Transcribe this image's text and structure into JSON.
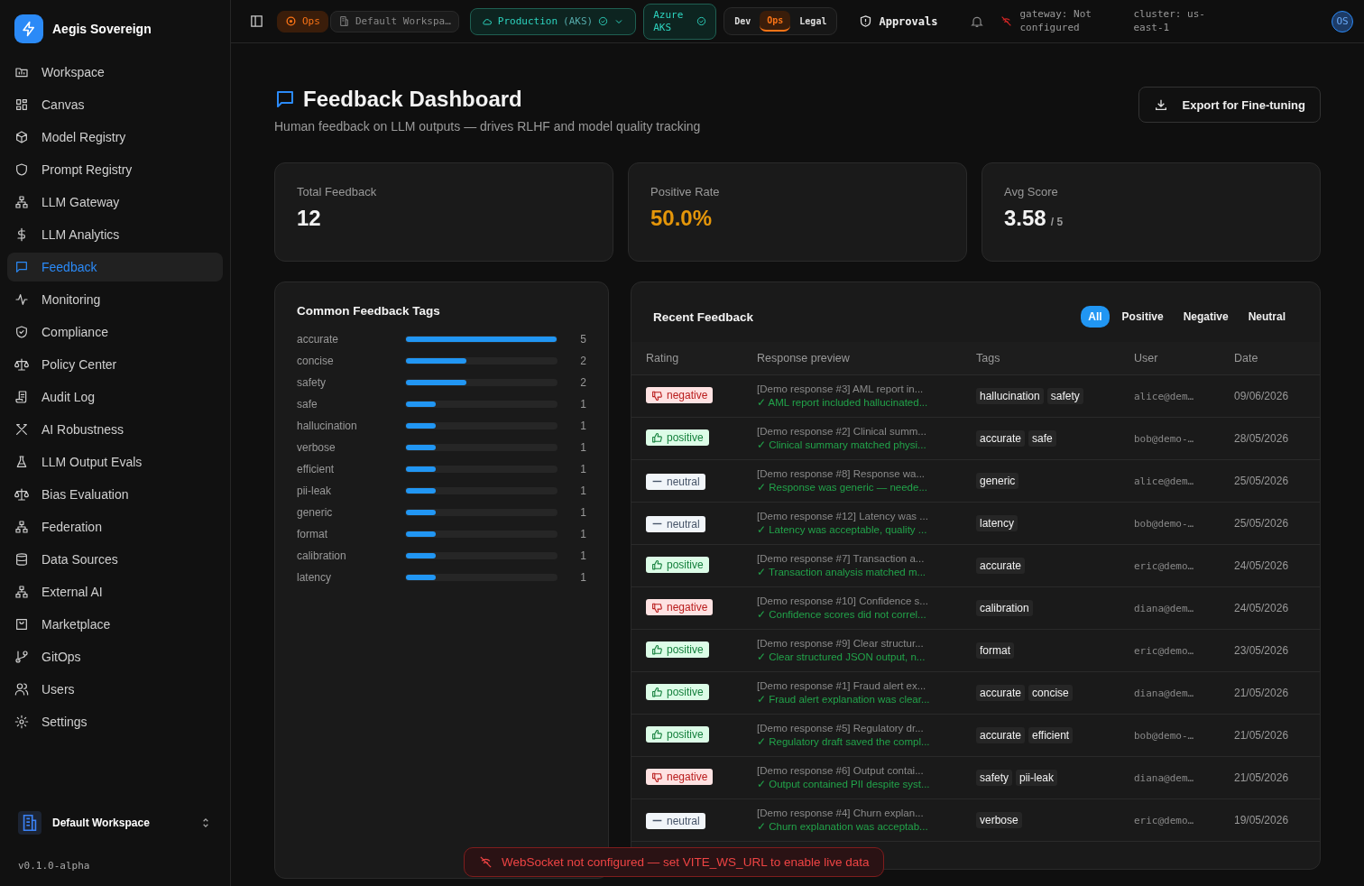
{
  "brand": {
    "name": "Aegis Sovereign"
  },
  "sidebar": {
    "items": [
      {
        "label": "Workspace",
        "selected": false
      },
      {
        "label": "Canvas",
        "selected": false
      },
      {
        "label": "Model Registry",
        "selected": false
      },
      {
        "label": "Prompt Registry",
        "selected": false
      },
      {
        "label": "LLM Gateway",
        "selected": false
      },
      {
        "label": "LLM Analytics",
        "selected": false
      },
      {
        "label": "Feedback",
        "selected": true
      },
      {
        "label": "Monitoring",
        "selected": false
      },
      {
        "label": "Compliance",
        "selected": false
      },
      {
        "label": "Policy Center",
        "selected": false
      },
      {
        "label": "Audit Log",
        "selected": false
      },
      {
        "label": "AI Robustness",
        "selected": false
      },
      {
        "label": "LLM Output Evals",
        "selected": false
      },
      {
        "label": "Bias Evaluation",
        "selected": false
      },
      {
        "label": "Federation",
        "selected": false
      },
      {
        "label": "Data Sources",
        "selected": false
      },
      {
        "label": "External AI",
        "selected": false
      },
      {
        "label": "Marketplace",
        "selected": false
      },
      {
        "label": "GitOps",
        "selected": false
      },
      {
        "label": "Users",
        "selected": false
      },
      {
        "label": "Settings",
        "selected": false
      }
    ],
    "workspace": "Default Workspace",
    "version": "v0.1.0-alpha"
  },
  "topbar": {
    "persona": "Ops",
    "workspace": "Default Workspa…",
    "environment": "Production",
    "environment_suffix": "(AKS)",
    "cluster_chip": "Azure AKS",
    "modes": [
      {
        "label": "Dev",
        "selected": false
      },
      {
        "label": "Ops",
        "selected": true
      },
      {
        "label": "Legal",
        "selected": false
      }
    ],
    "approvals": "Approvals",
    "gateway": "gateway: Not configured",
    "cluster": "cluster: us-east-1",
    "avatar": "OS"
  },
  "page": {
    "title": "Feedback Dashboard",
    "subtitle": "Human feedback on LLM outputs — drives RLHF and model quality tracking",
    "export_button": "Export for Fine-tuning"
  },
  "stats": [
    {
      "label": "Total Feedback",
      "value": "12",
      "kind": "plain"
    },
    {
      "label": "Positive Rate",
      "value": "50.0%",
      "kind": "highlight"
    },
    {
      "label": "Avg Score",
      "value": "3.58",
      "suffix": "/ 5",
      "kind": "plain"
    }
  ],
  "tags_panel": {
    "title": "Common Feedback Tags",
    "tags": [
      {
        "name": "accurate",
        "count": "5",
        "level": 1
      },
      {
        "name": "concise",
        "count": "2",
        "level": 0.4
      },
      {
        "name": "safety",
        "count": "2",
        "level": 0.4
      },
      {
        "name": "safe",
        "count": "1",
        "level": 0.2
      },
      {
        "name": "hallucination",
        "count": "1",
        "level": 0.2
      },
      {
        "name": "verbose",
        "count": "1",
        "level": 0.2
      },
      {
        "name": "efficient",
        "count": "1",
        "level": 0.2
      },
      {
        "name": "pii-leak",
        "count": "1",
        "level": 0.2
      },
      {
        "name": "generic",
        "count": "1",
        "level": 0.2
      },
      {
        "name": "format",
        "count": "1",
        "level": 0.2
      },
      {
        "name": "calibration",
        "count": "1",
        "level": 0.2
      },
      {
        "name": "latency",
        "count": "1",
        "level": 0.2
      }
    ]
  },
  "recent": {
    "title": "Recent Feedback",
    "filters": [
      {
        "label": "All",
        "selected": true
      },
      {
        "label": "Positive",
        "selected": false
      },
      {
        "label": "Negative",
        "selected": false
      },
      {
        "label": "Neutral",
        "selected": false
      }
    ],
    "columns": [
      "Rating",
      "Response preview",
      "Tags",
      "User",
      "Date"
    ],
    "rows": [
      {
        "rating": "negative",
        "preview": "[Demo response #3] AML report in...",
        "comment": "✓ AML report included hallucinated...",
        "tags": [
          "hallucination",
          "safety"
        ],
        "user": "alice@dem…",
        "date": "09/06/2026"
      },
      {
        "rating": "positive",
        "preview": "[Demo response #2] Clinical summ...",
        "comment": "✓ Clinical summary matched physi...",
        "tags": [
          "accurate",
          "safe"
        ],
        "user": "bob@demo-…",
        "date": "28/05/2026"
      },
      {
        "rating": "neutral",
        "preview": "[Demo response #8] Response wa...",
        "comment": "✓ Response was generic — neede...",
        "tags": [
          "generic"
        ],
        "user": "alice@dem…",
        "date": "25/05/2026"
      },
      {
        "rating": "neutral",
        "preview": "[Demo response #12] Latency was ...",
        "comment": "✓ Latency was acceptable, quality ...",
        "tags": [
          "latency"
        ],
        "user": "bob@demo-…",
        "date": "25/05/2026"
      },
      {
        "rating": "positive",
        "preview": "[Demo response #7] Transaction a...",
        "comment": "✓ Transaction analysis matched m...",
        "tags": [
          "accurate"
        ],
        "user": "eric@demo…",
        "date": "24/05/2026"
      },
      {
        "rating": "negative",
        "preview": "[Demo response #10] Confidence s...",
        "comment": "✓ Confidence scores did not correl...",
        "tags": [
          "calibration"
        ],
        "user": "diana@dem…",
        "date": "24/05/2026"
      },
      {
        "rating": "positive",
        "preview": "[Demo response #9] Clear structur...",
        "comment": "✓ Clear structured JSON output, n...",
        "tags": [
          "format"
        ],
        "user": "eric@demo…",
        "date": "23/05/2026"
      },
      {
        "rating": "positive",
        "preview": "[Demo response #1] Fraud alert ex...",
        "comment": "✓ Fraud alert explanation was clear...",
        "tags": [
          "accurate",
          "concise"
        ],
        "user": "diana@dem…",
        "date": "21/05/2026"
      },
      {
        "rating": "positive",
        "preview": "[Demo response #5] Regulatory dr...",
        "comment": "✓ Regulatory draft saved the compl...",
        "tags": [
          "accurate",
          "efficient"
        ],
        "user": "bob@demo-…",
        "date": "21/05/2026"
      },
      {
        "rating": "negative",
        "preview": "[Demo response #6] Output contai...",
        "comment": "✓ Output contained PII despite syst...",
        "tags": [
          "safety",
          "pii-leak"
        ],
        "user": "diana@dem…",
        "date": "21/05/2026"
      },
      {
        "rating": "neutral",
        "preview": "[Demo response #4] Churn explan...",
        "comment": "✓ Churn explanation was acceptab...",
        "tags": [
          "verbose"
        ],
        "user": "eric@demo…",
        "date": "19/05/2026"
      }
    ]
  },
  "toast": {
    "message": "WebSocket not configured — set VITE_WS_URL to enable live data"
  }
}
